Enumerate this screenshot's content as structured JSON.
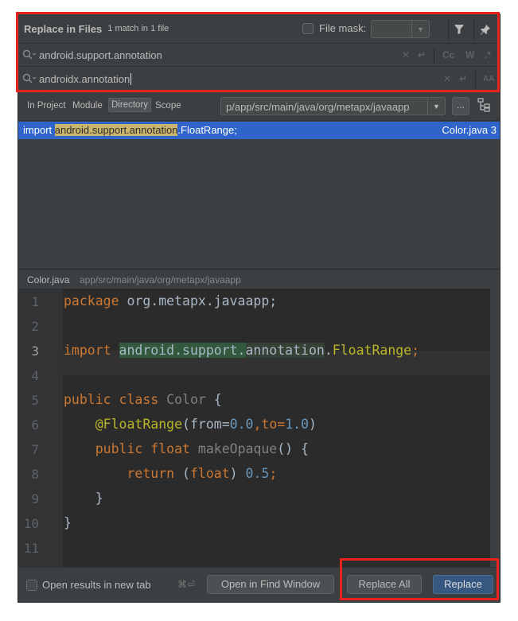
{
  "header": {
    "title": "Replace in Files",
    "match_count": "1 match in 1 file",
    "file_mask_label": "File mask:",
    "file_mask_value": ""
  },
  "search": {
    "find_value": "android.support.annotation",
    "replace_value": "androidx.annotation",
    "options": [
      "Cc",
      "W",
      ".*"
    ],
    "replace_options": [
      "AA"
    ]
  },
  "scope": {
    "tabs": [
      "In Project",
      "Module",
      "Directory",
      "Scope"
    ],
    "selected": "Directory",
    "directory_value": "p/app/src/main/java/org/metapx/javaapp",
    "browse_label": "..."
  },
  "results": [
    {
      "prefix": "import ",
      "match": "android.support.annotation",
      "suffix": ".FloatRange;",
      "file": "Color.java 3"
    }
  ],
  "preview": {
    "file": "Color.java",
    "path": "app/src/main/java/org/metapx/javaapp",
    "line_numbers": [
      "1",
      "2",
      "3",
      "4",
      "5",
      "6",
      "7",
      "8",
      "9",
      "10",
      "11"
    ],
    "current_line": "3",
    "lines": {
      "l1_kw": "package",
      "l1_rest": " org.metapx.javaapp;",
      "l3_kw": "import",
      "l3_match1": "android.support.",
      "l3_match2": "annotation",
      "l3_dot": ".",
      "l3_class": "FloatRange",
      "l3_end": ";",
      "l5_kw": "public class",
      "l5_name": " Color",
      "l5_brace": " {",
      "l6_ann": "@FloatRange",
      "l6_open": "(from=",
      "l6_n1": "0.0",
      "l6_mid": ",to=",
      "l6_n2": "1.0",
      "l6_close": ")",
      "l7_kw": "public float",
      "l7_name": " makeOpaque",
      "l7_rest": "() {",
      "l8_kw": "return",
      "l8_open": " (",
      "l8_type": "float",
      "l8_close": ") ",
      "l8_num": "0.5",
      "l8_end": ";",
      "l9": "}",
      "l10": "}"
    }
  },
  "footer": {
    "open_new_tab_label": "Open results in new tab",
    "shortcut": "⌘⏎",
    "open_find_window": "Open in Find Window",
    "replace_all": "Replace All",
    "replace": "Replace"
  },
  "colors": {
    "selection": "#2f65ca",
    "highlight_red": "#e8231d",
    "primary_button": "#365880"
  }
}
